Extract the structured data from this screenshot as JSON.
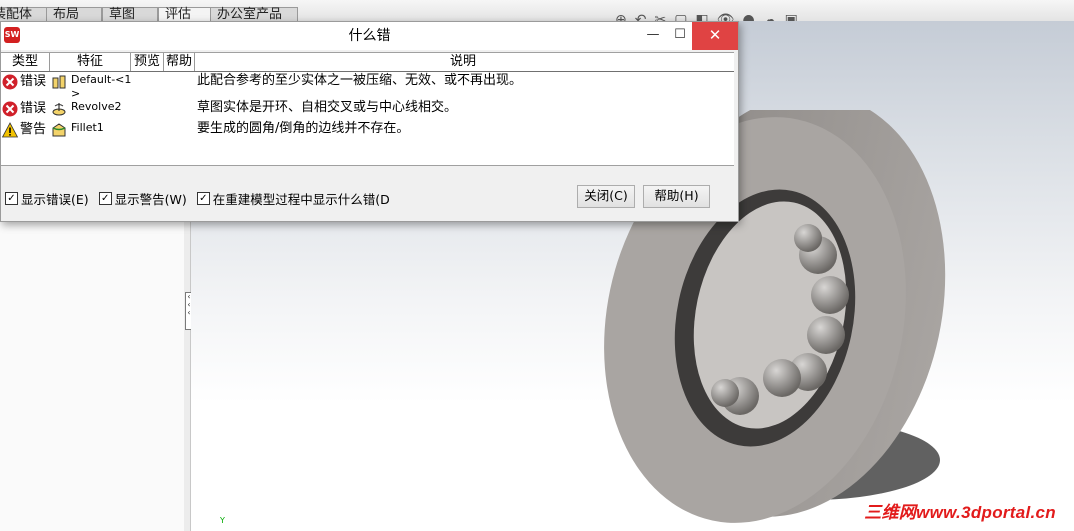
{
  "tabs": [
    "装配体",
    "布局",
    "草图",
    "评估",
    "办公室产品"
  ],
  "dialog": {
    "title": "什么错",
    "columns": [
      "类型",
      "特征",
      "预览",
      "帮助",
      "说明"
    ],
    "rows": [
      {
        "type": "错误",
        "feature": "Default-<1>",
        "description": "此配合参考的至少实体之一被压缩、无效、或不再出现。",
        "severity": "error"
      },
      {
        "type": "错误",
        "feature": "Revolve2",
        "description": "草图实体是开环、自相交叉或与中心线相交。",
        "severity": "error"
      },
      {
        "type": "警告",
        "feature": "Fillet1",
        "description": "要生成的圆角/倒角的边线并不存在。",
        "severity": "warning"
      }
    ],
    "options": [
      {
        "label": "显示错误(E)",
        "checked": true
      },
      {
        "label": "显示警告(W)",
        "checked": true
      },
      {
        "label": "在重建模型过程中显示什么错(D",
        "checked": true
      }
    ],
    "buttons": {
      "close": "关闭(C)",
      "help": "帮助(H)"
    }
  },
  "watermark": "三维网www.3dportal.cn",
  "triad_label": "Y",
  "colors": {
    "error": "#d0202a",
    "warning": "#f2c200",
    "close_btn": "#e04343",
    "watermark": "#e21b1b"
  }
}
